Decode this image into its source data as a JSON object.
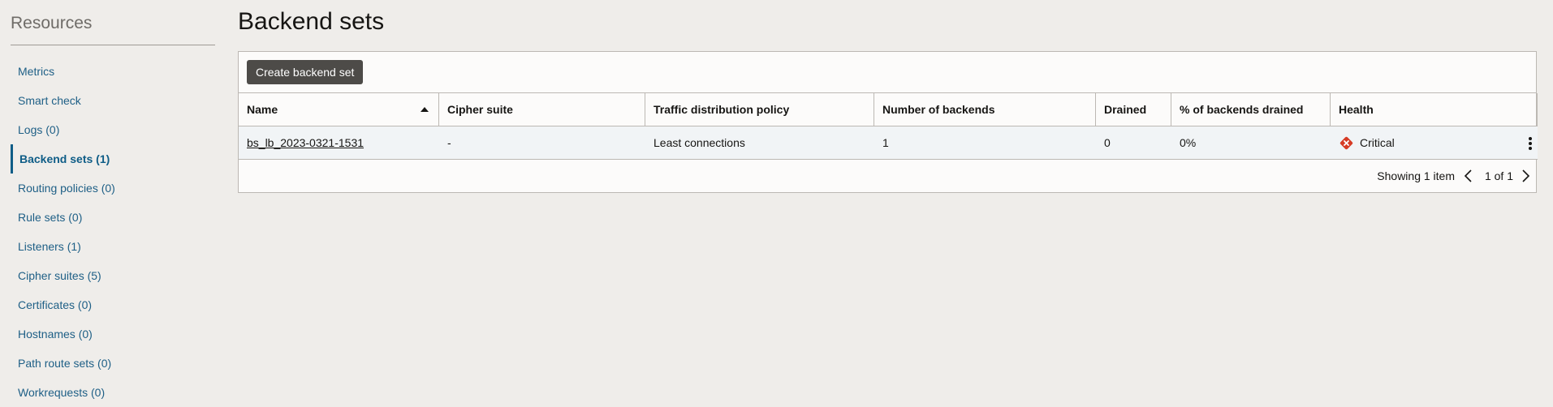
{
  "sidebar": {
    "title": "Resources",
    "items": [
      {
        "label": "Metrics"
      },
      {
        "label": "Smart check"
      },
      {
        "label": "Logs (0)"
      },
      {
        "label": "Backend sets (1)",
        "active": true
      },
      {
        "label": "Routing policies (0)"
      },
      {
        "label": "Rule sets (0)"
      },
      {
        "label": "Listeners (1)"
      },
      {
        "label": "Cipher suites (5)"
      },
      {
        "label": "Certificates (0)"
      },
      {
        "label": "Hostnames (0)"
      },
      {
        "label": "Path route sets (0)"
      },
      {
        "label": "Workrequests (0)"
      }
    ]
  },
  "main": {
    "title": "Backend sets",
    "create_button": "Create backend set",
    "table": {
      "columns": [
        "Name",
        "Cipher suite",
        "Traffic distribution policy",
        "Number of backends",
        "Drained",
        "% of backends drained",
        "Health"
      ],
      "sort": {
        "column": "Name",
        "direction": "ascending"
      },
      "rows": [
        {
          "name": "bs_lb_2023-0321-1531",
          "cipher_suite": "-",
          "policy": "Least connections",
          "backends": "1",
          "drained": "0",
          "pct_drained": "0%",
          "health": "Critical"
        }
      ]
    },
    "pagination": {
      "showing": "Showing 1 item",
      "page": "1 of 1"
    }
  },
  "colors": {
    "critical": "#d63b25",
    "link": "#1e5f86",
    "button": "#4d4b48"
  }
}
